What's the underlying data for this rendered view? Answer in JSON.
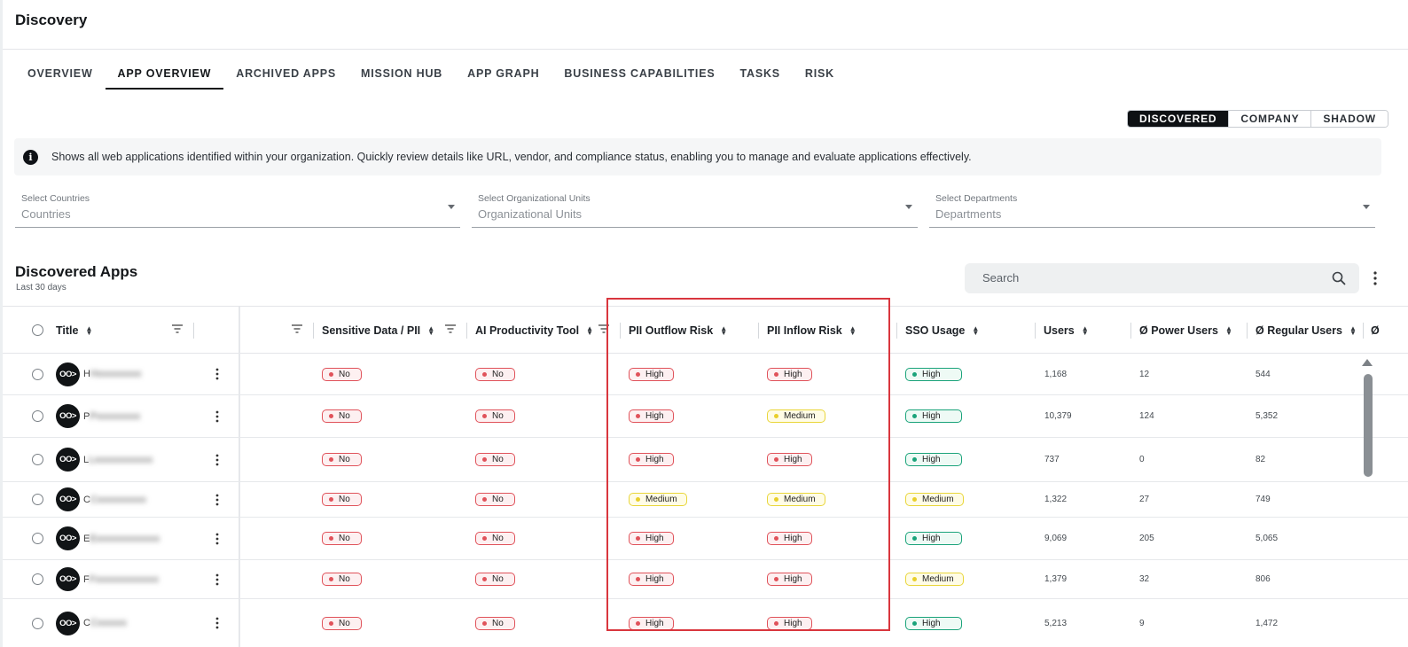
{
  "page": {
    "title": "Discovery"
  },
  "tabs": [
    "OVERVIEW",
    "APP OVERVIEW",
    "ARCHIVED APPS",
    "MISSION HUB",
    "APP GRAPH",
    "BUSINESS CAPABILITIES",
    "TASKS",
    "RISK"
  ],
  "active_tab": "APP OVERVIEW",
  "view_toggle": {
    "discovered": "DISCOVERED",
    "company": "COMPANY",
    "shadow": "SHADOW",
    "selected": "DISCOVERED"
  },
  "info": {
    "icon": "info-icon",
    "text": "Shows all web applications identified within your organization. Quickly review details like URL, vendor, and compliance status, enabling you to manage and evaluate applications effectively."
  },
  "filters": {
    "countries": {
      "label": "Select Countries",
      "placeholder": "Countries"
    },
    "org_units": {
      "label": "Select Organizational Units",
      "placeholder": "Organizational Units"
    },
    "departments": {
      "label": "Select Departments",
      "placeholder": "Departments"
    }
  },
  "section": {
    "title": "Discovered Apps",
    "subtitle": "Last 30 days"
  },
  "search": {
    "placeholder": "Search"
  },
  "columns": {
    "title": "Title",
    "sensitive": "Sensitive Data / PII",
    "ai_tool": "AI Productivity Tool",
    "pii_out": "PII Outflow Risk",
    "pii_in": "PII Inflow Risk",
    "sso": "SSO Usage",
    "users": "Users",
    "power": "Ø Power Users",
    "regular": "Ø Regular Users",
    "overflow": "Ø"
  },
  "avatar_text": "OO>",
  "badge_colors": {
    "No": "red",
    "High": "red",
    "Medium": "yellow",
    "sso_High": "green",
    "sso_Medium": "yellow"
  },
  "rows": [
    {
      "initial": "H",
      "blur": "Hxxxxxxxxx",
      "sensitive": "No",
      "ai": "No",
      "pii_out": "High",
      "pii_in": "High",
      "sso": "High",
      "users": "1,168",
      "power": "12",
      "regular": "544"
    },
    {
      "initial": "P",
      "blur": "Pxxxxxxxxx",
      "sensitive": "No",
      "ai": "No",
      "pii_out": "High",
      "pii_in": "Medium",
      "sso": "High",
      "users": "10,379",
      "power": "124",
      "regular": "5,352"
    },
    {
      "initial": "L",
      "blur": "Lxxxxxxxxxxxx",
      "sensitive": "No",
      "ai": "No",
      "pii_out": "High",
      "pii_in": "High",
      "sso": "High",
      "users": "737",
      "power": "0",
      "regular": "82"
    },
    {
      "initial": "C",
      "blur": "Cxxxxxxxxxx",
      "sensitive": "No",
      "ai": "No",
      "pii_out": "Medium",
      "pii_in": "Medium",
      "sso": "Medium",
      "users": "1,322",
      "power": "27",
      "regular": "749"
    },
    {
      "initial": "E",
      "blur": "Exxxxxxxxxxxxx",
      "sensitive": "No",
      "ai": "No",
      "pii_out": "High",
      "pii_in": "High",
      "sso": "High",
      "users": "9,069",
      "power": "205",
      "regular": "5,065"
    },
    {
      "initial": "F",
      "blur": "Fxxxxxxxxxxxxx",
      "sensitive": "No",
      "ai": "No",
      "pii_out": "High",
      "pii_in": "High",
      "sso": "Medium",
      "users": "1,379",
      "power": "32",
      "regular": "806"
    },
    {
      "initial": "C",
      "blur": "Cxxxxxx",
      "sensitive": "No",
      "ai": "No",
      "pii_out": "High",
      "pii_in": "High",
      "sso": "High",
      "users": "5,213",
      "power": "9",
      "regular": "1,472"
    }
  ]
}
